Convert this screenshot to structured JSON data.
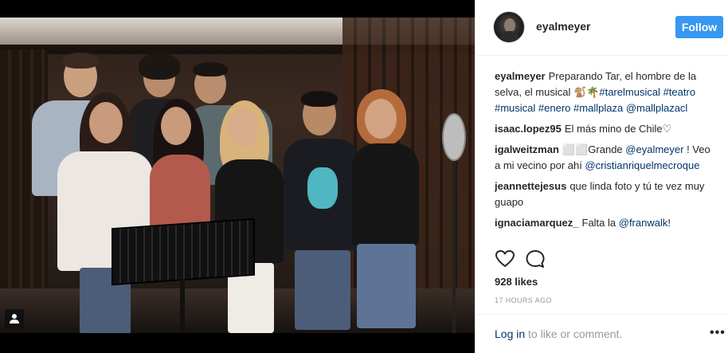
{
  "post": {
    "author": "eyalmeyer",
    "follow_label": "Follow",
    "likes": "928 likes",
    "timestamp": "17 HOURS AGO"
  },
  "comments": [
    {
      "user": "eyalmeyer",
      "parts": [
        {
          "text": "Preparando Tar, el hombre de la selva, el musical 🐒🌴",
          "link": false
        },
        {
          "text": "#tarelmusical",
          "link": true
        },
        {
          "text": " ",
          "link": false
        },
        {
          "text": "#teatro",
          "link": true
        },
        {
          "text": " ",
          "link": false
        },
        {
          "text": "#musical",
          "link": true
        },
        {
          "text": " ",
          "link": false
        },
        {
          "text": "#enero",
          "link": true
        },
        {
          "text": " ",
          "link": false
        },
        {
          "text": "#mallplaza",
          "link": true
        },
        {
          "text": " ",
          "link": false
        },
        {
          "text": "@mallplazacl",
          "link": true
        }
      ]
    },
    {
      "user": "isaac.lopez95",
      "parts": [
        {
          "text": "El más mino de Chile♡",
          "link": false
        }
      ]
    },
    {
      "user": "igalweitzman",
      "parts": [
        {
          "text": "⬜⬜Grande ",
          "link": false
        },
        {
          "text": "@eyalmeyer",
          "link": true
        },
        {
          "text": " ! Veo a mi vecino por ahí ",
          "link": false
        },
        {
          "text": "@cristianriquelmecroque",
          "link": true
        }
      ]
    },
    {
      "user": "jeannettejesus",
      "parts": [
        {
          "text": "que linda foto y tú te vez muy guapo",
          "link": false
        }
      ]
    },
    {
      "user": "ignaciamarquez_",
      "parts": [
        {
          "text": "Falta la ",
          "link": false
        },
        {
          "text": "@franwalk",
          "link": true
        },
        {
          "text": "!",
          "link": false
        }
      ]
    }
  ],
  "footer": {
    "login_link": "Log in",
    "login_rest": " to like or comment.",
    "more_label": "•••"
  },
  "icons": {
    "like": "heart-icon",
    "comment": "comment-bubble-icon",
    "user_tag": "user-tag-icon"
  },
  "colors": {
    "follow": "#3897f0",
    "link": "#003569",
    "muted": "#999999"
  }
}
